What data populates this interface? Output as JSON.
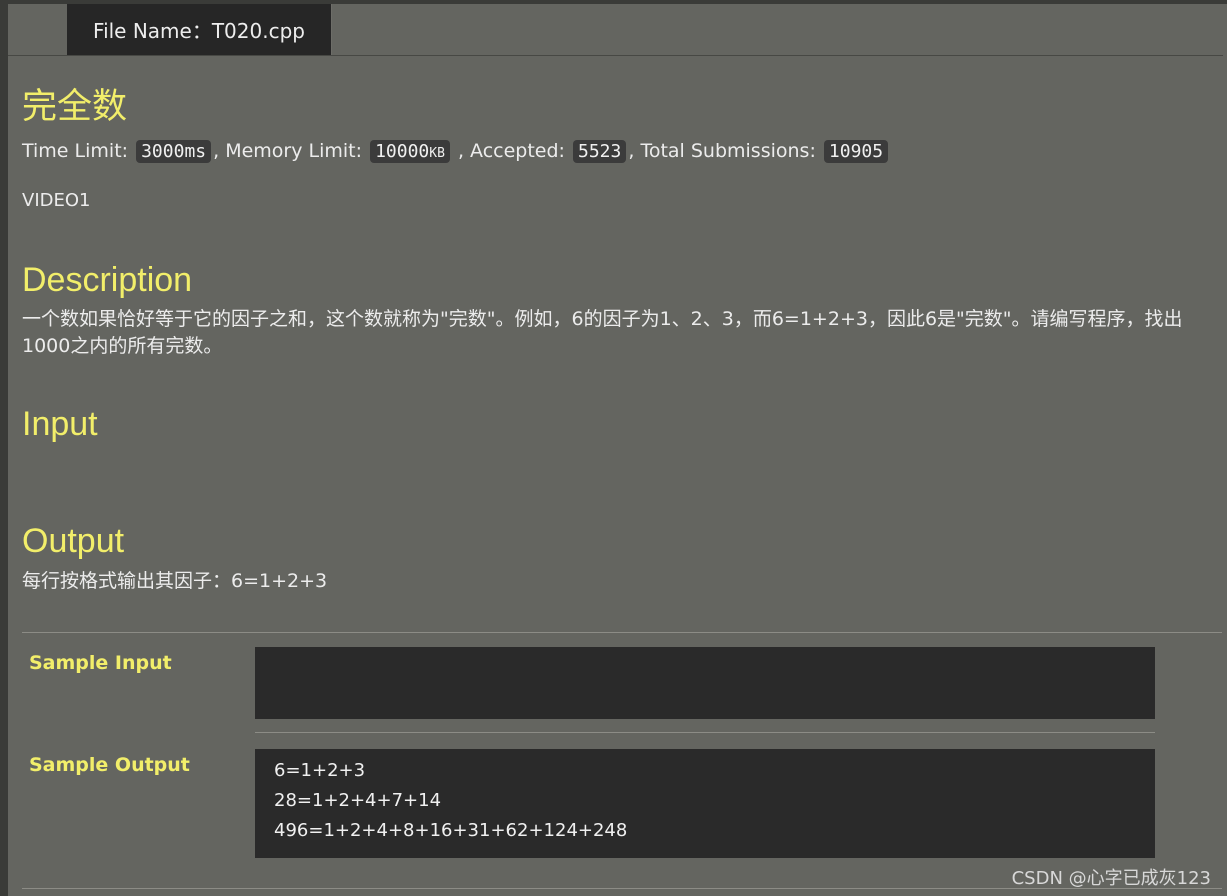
{
  "tab": {
    "file_name": "File Name：T020.cpp"
  },
  "problem": {
    "title": "完全数",
    "meta": {
      "time_limit_label": "Time Limit: ",
      "time_limit_value": "3000",
      "time_limit_unit": "ms",
      "memory_limit_label": ", Memory Limit: ",
      "memory_limit_value": "10000",
      "memory_limit_unit": "KB",
      "accepted_label": " , Accepted: ",
      "accepted_value": "5523",
      "total_label": ", Total Submissions: ",
      "total_value": "10905"
    },
    "video_label": "VIDEO1",
    "description_heading": "Description",
    "description_text": "一个数如果恰好等于它的因子之和，这个数就称为\"完数\"。例如，6的因子为1、2、3，而6=1+2+3，因此6是\"完数\"。请编写程序，找出1000之内的所有完数。",
    "input_heading": "Input",
    "output_heading": "Output",
    "output_text": "每行按格式输出其因子：6=1+2+3"
  },
  "samples": {
    "input_label": "Sample Input",
    "input_lines": [],
    "output_label": "Sample Output",
    "output_lines": [
      "6=1+2+3",
      "28=1+2+4+7+14",
      "496=1+2+4+8+16+31+62+124+248"
    ]
  },
  "watermark": "CSDN @心字已成灰123",
  "colors": {
    "background": "#646560",
    "heading_yellow": "#f2ee6a",
    "code_bg": "#2a2a2a",
    "tab_bg": "#262626"
  }
}
